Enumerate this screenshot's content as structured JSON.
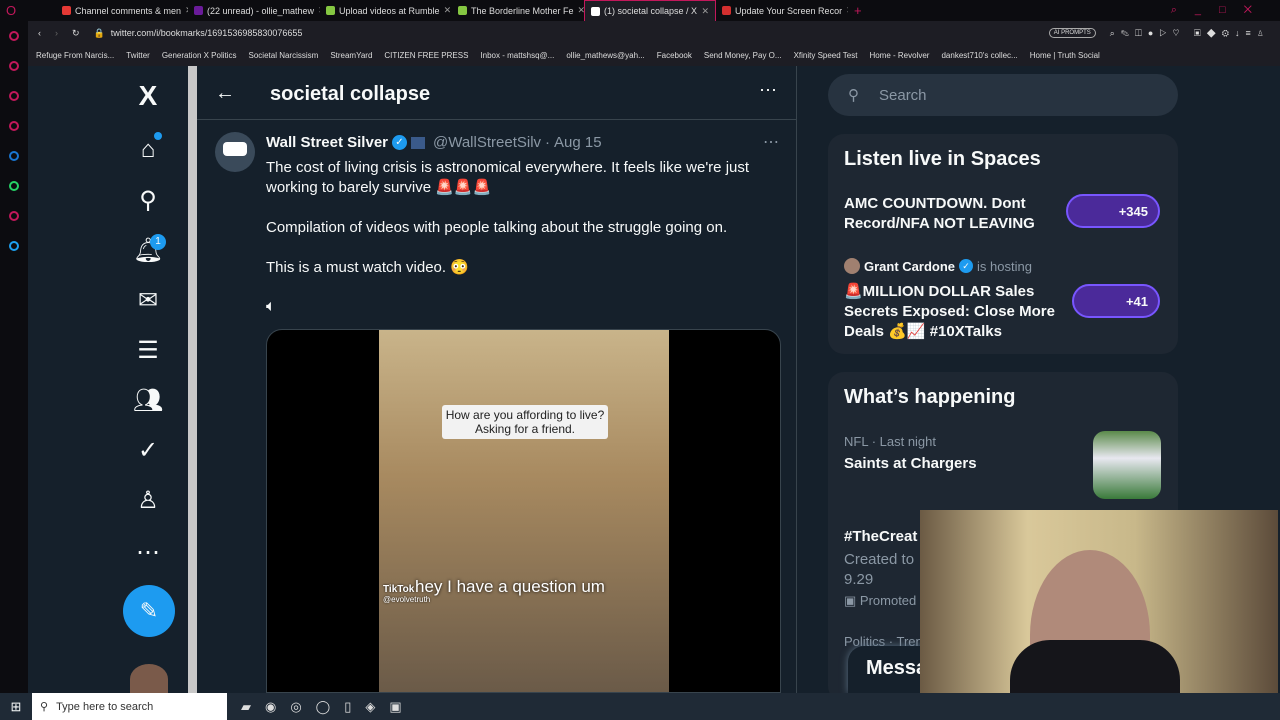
{
  "browser": {
    "tabs": [
      {
        "label": "Channel comments & men",
        "color": "#e53935"
      },
      {
        "label": "(22 unread) - ollie_mathew",
        "color": "#6a1b9a"
      },
      {
        "label": "Upload videos at Rumble",
        "color": "#85c742"
      },
      {
        "label": "The Borderline Mother Fe",
        "color": "#85c742"
      },
      {
        "label": "(1) societal collapse / X",
        "color": "#ffffff",
        "active": true
      },
      {
        "label": "Update Your Screen Recor",
        "color": "#d32f2f"
      }
    ],
    "url": "twitter.com/i/bookmarks/1691536985830076655",
    "ai_prompts": "AI PROMPTS",
    "bookmarks": [
      "Refuge From Narcis...",
      "Twitter",
      "Generation X Politics",
      "Societal Narcissism",
      "StreamYard",
      "CITIZEN FREE PRESS",
      "Inbox - mattshsq@...",
      "ollie_mathews@yah...",
      "Facebook",
      "Send Money, Pay O...",
      "Xfinity Speed Test",
      "Home - Revolver",
      "dankest710's collec...",
      "Home | Truth Social"
    ]
  },
  "nav": {
    "logo": "X",
    "notif_count": "1",
    "icons": [
      "home-icon",
      "search-icon",
      "bell-icon",
      "mail-icon",
      "lists-icon",
      "communities-icon",
      "verified-icon",
      "profile-icon",
      "more-icon"
    ]
  },
  "header": {
    "title": "societal collapse"
  },
  "tweet": {
    "name": "Wall Street Silver",
    "handle": "@WallStreetSilv",
    "date": "Aug 15",
    "lines": [
      "The cost of living crisis is astronomical everywhere. It feels like we're just working to barely survive 🚨🚨🚨",
      "Compilation of videos with people talking about the struggle going on.",
      "This is a must watch video. 😳"
    ],
    "video_caption": "How are you affording to live? Asking for a friend.",
    "video_subtitle": "hey I have a question um",
    "tiktok": "TikTok",
    "tiktok_user": "@evolvetruth"
  },
  "search": {
    "placeholder": "Search"
  },
  "spaces": {
    "title": "Listen live in Spaces",
    "items": [
      {
        "title": "AMC COUNTDOWN. Dont Record/NFA NOT LEAVING",
        "count": "+345"
      },
      {
        "host": "Grant Cardone",
        "hosting": "is hosting",
        "title": "🚨MILLION DOLLAR Sales Secrets Exposed: Close More Deals 💰📈 #10XTalks",
        "count": "+41"
      }
    ]
  },
  "happening": {
    "title": "What’s happening",
    "items": [
      {
        "meta": "NFL · Last night",
        "title": "Saints at Chargers"
      },
      {
        "title": "#TheCreat",
        "desc": "Created to",
        "desc2": "9.29",
        "promoted": "Promoted"
      },
      {
        "meta": "Politics · Tren"
      }
    ]
  },
  "messages": {
    "label": "Messa"
  },
  "taskbar": {
    "search_placeholder": "Type here to search"
  }
}
